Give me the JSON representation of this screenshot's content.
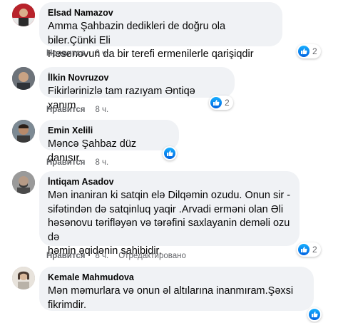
{
  "like_label": "Нравится",
  "edited_label": "Отредактировано",
  "comments": [
    {
      "author": "Elsad Namazov",
      "lines": [
        "Amma Şahbazin dedikleri de doğru ola biler.Çünki Eli",
        "Hesenovun da bir terefi ermenilerle qarişiqdir"
      ],
      "time": "8 ч.",
      "reactions": "2",
      "avatar_color": "#7a1f23"
    },
    {
      "author": "İlkin Novruzov",
      "lines": [
        "Fikirlərinizlə tam razıyam Əntiqə xanım"
      ],
      "time": "8 ч.",
      "reactions": "2",
      "avatar_color": "#5a5f66"
    },
    {
      "author": "Emin Xelili",
      "lines": [
        "Məncə Şahbaz düz danışır."
      ],
      "time": "8 ч.",
      "reactions": "",
      "avatar_color": "#4b3a2e"
    },
    {
      "author": "İntiqam Asadov",
      "lines": [
        "Mən inaniran ki satqin elə Dilqəmin ozudu. Onun sir -",
        "sifətindən də satqinluq yaqir .Arvadi erməni olan Əli",
        "həsənovu tərifləyən və tərəfini saxlayanin deməli ozu də",
        "həmin əqidənin sahibidir."
      ],
      "time": "8 ч.",
      "edited": true,
      "reactions": "2",
      "avatar_color": "#6b6b6b"
    },
    {
      "author": "Kemale Mahmudova",
      "lines": [
        "Mən məmurlara və onun əl altılarına inanmıram.Şəxsi",
        "fikrimdir."
      ],
      "time": "",
      "reactions": "",
      "avatar_color": "#a7a39c"
    }
  ]
}
